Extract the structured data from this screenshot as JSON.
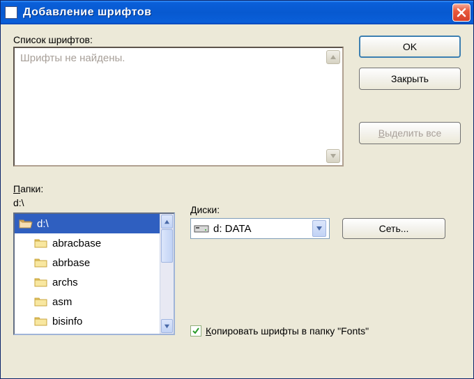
{
  "title": "Добавление шрифтов",
  "font_list": {
    "label": "Список шрифтов:",
    "placeholder": "Шрифты не найдены."
  },
  "buttons": {
    "ok": "OK",
    "close": "Закрыть",
    "select_all": "Выделить все",
    "network": "Сеть..."
  },
  "folders": {
    "label": "Папки:",
    "current_path": "d:\\",
    "items": [
      {
        "label": "d:\\",
        "selected": true,
        "open": true
      },
      {
        "label": "abracbase",
        "selected": false,
        "open": false
      },
      {
        "label": "abrbase",
        "selected": false,
        "open": false
      },
      {
        "label": "archs",
        "selected": false,
        "open": false
      },
      {
        "label": "asm",
        "selected": false,
        "open": false
      },
      {
        "label": "bisinfo",
        "selected": false,
        "open": false
      }
    ]
  },
  "drives": {
    "label": "Диски:",
    "selected": "d: DATA"
  },
  "copy_checkbox": {
    "label": "Копировать шрифты в папку \"Fonts\"",
    "checked": true
  }
}
